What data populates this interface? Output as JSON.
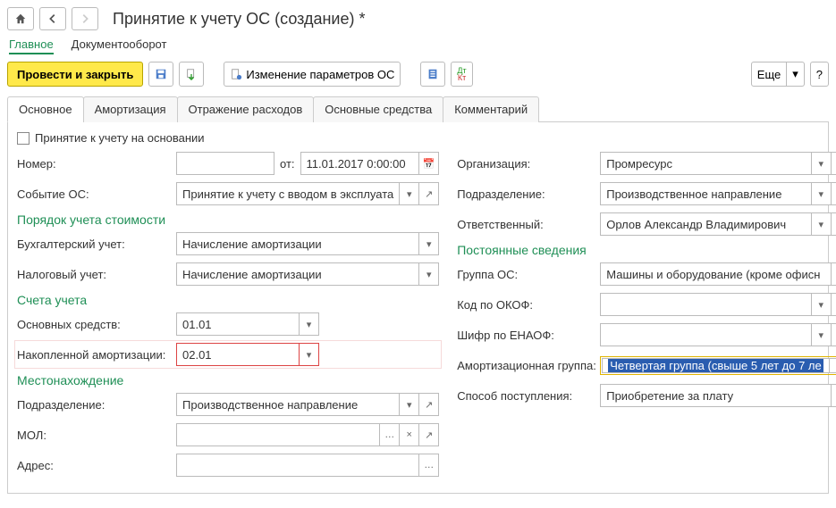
{
  "header": {
    "title": "Принятие к учету ОС (создание) *"
  },
  "viewtabs": {
    "main": "Главное",
    "docflow": "Документооборот"
  },
  "toolbar": {
    "post_close": "Провести и закрыть",
    "change_params": "Изменение параметров ОС",
    "more": "Еще",
    "help": "?"
  },
  "tabs": {
    "t1": "Основное",
    "t2": "Амортизация",
    "t3": "Отражение расходов",
    "t4": "Основные средства",
    "t5": "Комментарий"
  },
  "left": {
    "chk_basis": "Принятие к учету на основании",
    "number_label": "Номер:",
    "number_value": "",
    "from_label": "от:",
    "date_value": "11.01.2017  0:00:00",
    "event_label": "Событие ОС:",
    "event_value": "Принятие к учету с вводом в эксплуата",
    "section_cost": "Порядок учета стоимости",
    "bu_label": "Бухгалтерский учет:",
    "bu_value": "Начисление амортизации",
    "nu_label": "Налоговый учет:",
    "nu_value": "Начисление амортизации",
    "section_accounts": "Счета учета",
    "acc_os_label": "Основных средств:",
    "acc_os_value": "01.01",
    "acc_amort_label": "Накопленной амортизации:",
    "acc_amort_value": "02.01",
    "section_loc": "Местонахождение",
    "dept_label": "Подразделение:",
    "dept_value": "Производственное направление",
    "mol_label": "МОЛ:",
    "mol_value": "",
    "addr_label": "Адрес:",
    "addr_value": ""
  },
  "right": {
    "org_label": "Организация:",
    "org_value": "Промресурс",
    "dept_label": "Подразделение:",
    "dept_value": "Производственное направление",
    "resp_label": "Ответственный:",
    "resp_value": "Орлов Александр Владимирович",
    "section_const": "Постоянные сведения",
    "group_label": "Группа ОС:",
    "group_value": "Машины и оборудование (кроме офисн",
    "okof_label": "Код по ОКОФ:",
    "okof_value": "",
    "enaof_label": "Шифр по ЕНАОФ:",
    "enaof_value": "",
    "amort_group_label": "Амортизационная группа:",
    "amort_group_value": "Четвертая группа (свыше 5 лет до 7 ле",
    "method_label": "Способ поступления:",
    "method_value": "Приобретение за плату"
  },
  "icons": {
    "caret": "▾",
    "dots": "…",
    "x": "×",
    "open": "↗",
    "cal": "📅"
  }
}
